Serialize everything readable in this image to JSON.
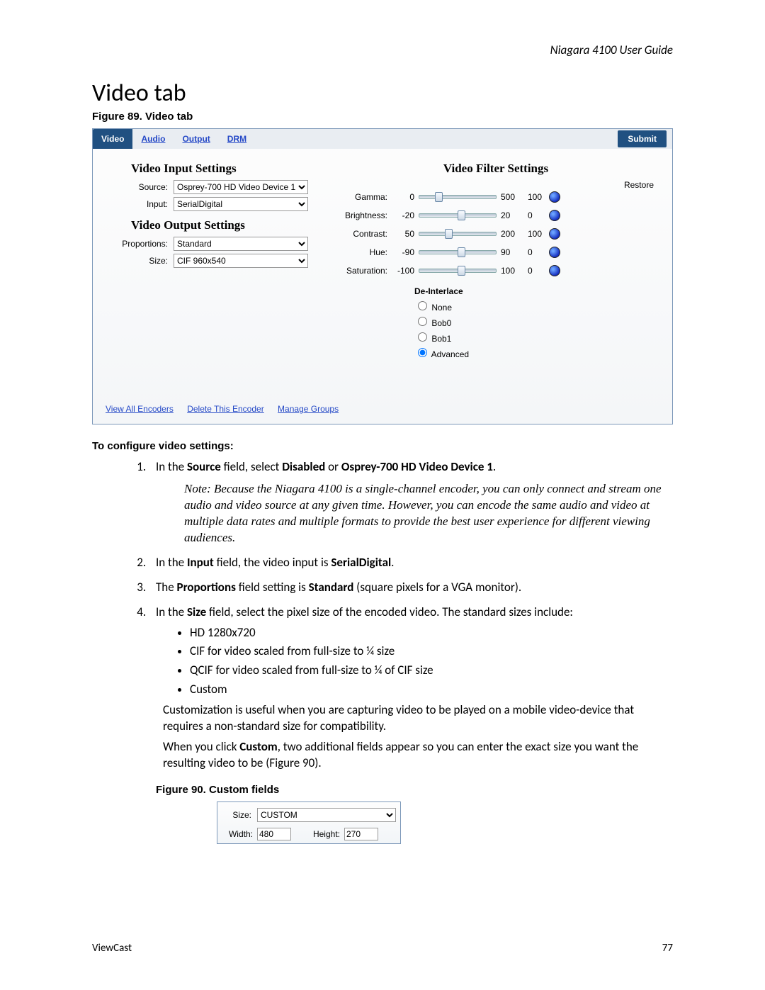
{
  "doc": {
    "guide_title": "Niagara 4100 User Guide",
    "page_title": "Video tab",
    "fig89_caption": "Figure 89. Video tab",
    "fig90_caption": "Figure 90. Custom fields",
    "vendor": "ViewCast",
    "page_num": "77"
  },
  "panel": {
    "tabs": [
      "Video",
      "Audio",
      "Output",
      "DRM"
    ],
    "active_tab": "Video",
    "submit": "Submit",
    "input_head": "Video Input Settings",
    "output_head": "Video Output Settings",
    "filter_head": "Video Filter Settings",
    "restore_label": "Restore",
    "source_label": "Source:",
    "source_value": "Osprey-700 HD Video Device 1",
    "input_label": "Input:",
    "input_value": "SerialDigital",
    "proportions_label": "Proportions:",
    "proportions_value": "Standard",
    "size_label": "Size:",
    "size_value": "CIF 960x540",
    "filters": [
      {
        "name": "Gamma:",
        "min": "0",
        "max": "500",
        "value": "100",
        "thumb_pct": 20
      },
      {
        "name": "Brightness:",
        "min": "-20",
        "max": "20",
        "value": "0",
        "thumb_pct": 50
      },
      {
        "name": "Contrast:",
        "min": "50",
        "max": "200",
        "value": "100",
        "thumb_pct": 33
      },
      {
        "name": "Hue:",
        "min": "-90",
        "max": "90",
        "value": "0",
        "thumb_pct": 50
      },
      {
        "name": "Saturation:",
        "min": "-100",
        "max": "100",
        "value": "0",
        "thumb_pct": 50
      }
    ],
    "deinterlace_head": "De-Interlace",
    "deinterlace_options": [
      "None",
      "Bob0",
      "Bob1",
      "Advanced"
    ],
    "deinterlace_selected": "Advanced",
    "footer_links": [
      "View All Encoders",
      "Delete This Encoder",
      "Manage Groups"
    ]
  },
  "instr": {
    "head": "To configure video settings:",
    "step1_pre": "In the ",
    "step1_b1": "Source",
    "step1_mid": " field, select ",
    "step1_b2": "Disabled",
    "step1_mid2": " or ",
    "step1_b3": "Osprey-700 HD Video Device 1",
    "step1_end": ".",
    "note": "Note: Because the Niagara 4100 is a single-channel encoder, you can only connect and stream one audio and video source at any given time. However, you can encode the same audio and video at multiple data rates and multiple formats to provide the best user experience for different viewing audiences.",
    "step2_pre": "In the ",
    "step2_b1": "Input",
    "step2_mid": " field, the video input is ",
    "step2_b2": "SerialDigital",
    "step2_end": ".",
    "step3_pre": "The ",
    "step3_b1": "Proportions",
    "step3_mid": " field setting is ",
    "step3_b2": "Standard",
    "step3_end": " (square pixels for a VGA monitor).",
    "step4_pre": "In the ",
    "step4_b1": "Size",
    "step4_end": " field, select the pixel size of the encoded video. The standard sizes include:",
    "bullets": [
      "HD 1280x720",
      "CIF for video scaled from full-size to ¼ size",
      "QCIF for video scaled from full-size to ¼ of CIF size",
      "Custom"
    ],
    "custom_para1": "Customization is useful when you are capturing video to be played on a mobile video-device that requires a non-standard size for compatibility.",
    "custom_para2_pre": "When you click ",
    "custom_para2_b": "Custom",
    "custom_para2_end": ", two additional fields appear so you can enter the exact size you want the resulting video to be (Figure 90)."
  },
  "custom_fields": {
    "size_label": "Size:",
    "size_value": "CUSTOM",
    "width_label": "Width:",
    "width_value": "480",
    "height_label": "Height:",
    "height_value": "270"
  }
}
